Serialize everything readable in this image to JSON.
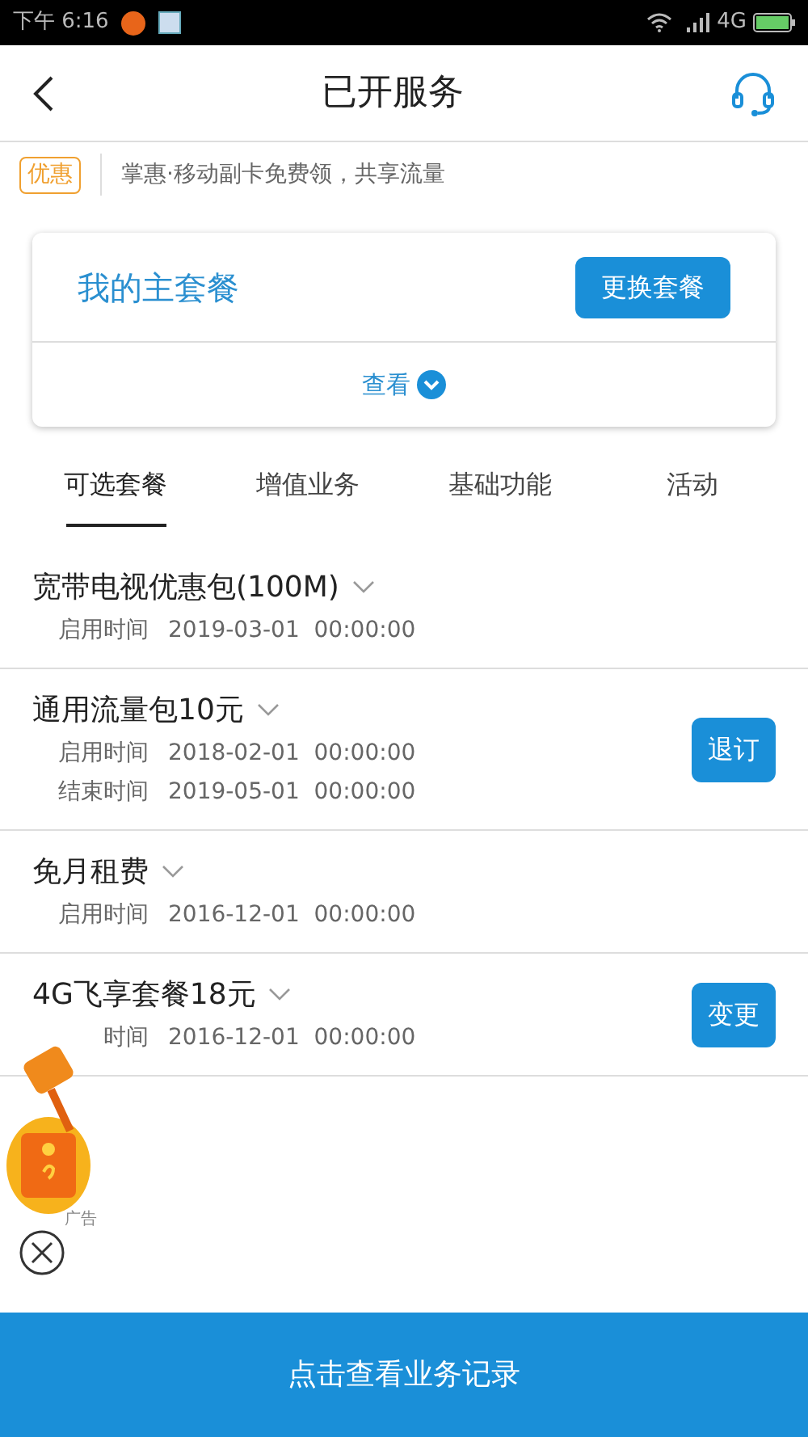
{
  "status_bar": {
    "time": "下午 6:16",
    "network": "4G"
  },
  "header": {
    "title": "已开服务"
  },
  "promo": {
    "badge": "优惠",
    "text": "掌惠·移动副卡免费领，共享流量"
  },
  "main_plan": {
    "title": "我的主套餐",
    "button": "更换套餐",
    "toggle": "查看",
    "expanded": false
  },
  "tabs": [
    {
      "label": "可选套餐",
      "selected": true
    },
    {
      "label": "增值业务",
      "selected": false
    },
    {
      "label": "基础功能",
      "selected": false
    },
    {
      "label": "活动",
      "selected": false
    }
  ],
  "services": [
    {
      "name": "宽带电视优惠包(100M)",
      "lines": [
        {
          "label": "启用时间",
          "value": "2019-03-01  00:00:00"
        }
      ]
    },
    {
      "name": "通用流量包10元",
      "lines": [
        {
          "label": "启用时间",
          "value": "2018-02-01  00:00:00"
        },
        {
          "label": "结束时间",
          "value": "2019-05-01  00:00:00"
        }
      ],
      "action": "退订"
    },
    {
      "name": "免月租费",
      "lines": [
        {
          "label": "启用时间",
          "value": "2016-12-01  00:00:00"
        }
      ]
    },
    {
      "name": "4G飞享套餐18元",
      "lines": [
        {
          "label": "时间",
          "value": "2016-12-01  00:00:00"
        }
      ],
      "action": "变更"
    }
  ],
  "floating_ad": {
    "label": "广告"
  },
  "footer": {
    "button": "点击查看业务记录"
  }
}
